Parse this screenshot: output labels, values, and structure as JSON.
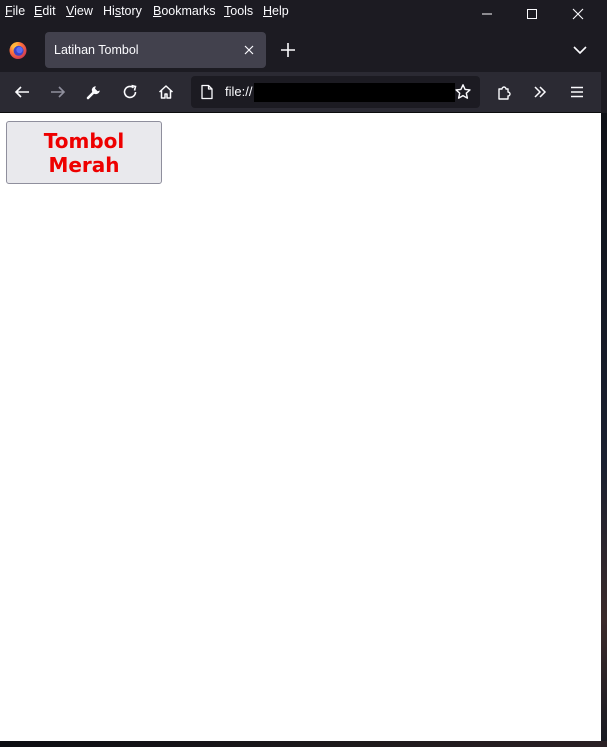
{
  "menubar": {
    "items": [
      {
        "pre": "",
        "key": "F",
        "post": "ile"
      },
      {
        "pre": "",
        "key": "E",
        "post": "dit"
      },
      {
        "pre": "",
        "key": "V",
        "post": "iew"
      },
      {
        "pre": "Hi",
        "key": "s",
        "post": "tory"
      },
      {
        "pre": "",
        "key": "B",
        "post": "ookmarks"
      },
      {
        "pre": "",
        "key": "T",
        "post": "ools"
      },
      {
        "pre": "",
        "key": "H",
        "post": "elp"
      }
    ]
  },
  "tabs": [
    {
      "title": "Latihan Tombol",
      "active": true
    }
  ],
  "urlbar": {
    "text": "file://"
  },
  "page": {
    "button_label": "Tombol Merah"
  },
  "colors": {
    "chrome_dark": "#1c1b22",
    "toolbar": "#2b2a33",
    "active_tab": "#42414d",
    "button_text": "#ee0000",
    "button_bg": "#e9e9ed"
  },
  "icons": {
    "window_controls": [
      "minimize-icon",
      "maximize-icon",
      "close-icon"
    ],
    "tabstrip": [
      "firefox-logo-icon",
      "tab-close-icon",
      "new-tab-icon",
      "list-all-tabs-icon"
    ],
    "navbar": [
      "back-arrow-icon",
      "forward-arrow-icon",
      "wrench-icon",
      "reload-icon",
      "home-icon",
      "page-icon",
      "bookmark-star-icon",
      "extensions-icon",
      "overflow-chevrons-icon",
      "hamburger-menu-icon"
    ]
  }
}
